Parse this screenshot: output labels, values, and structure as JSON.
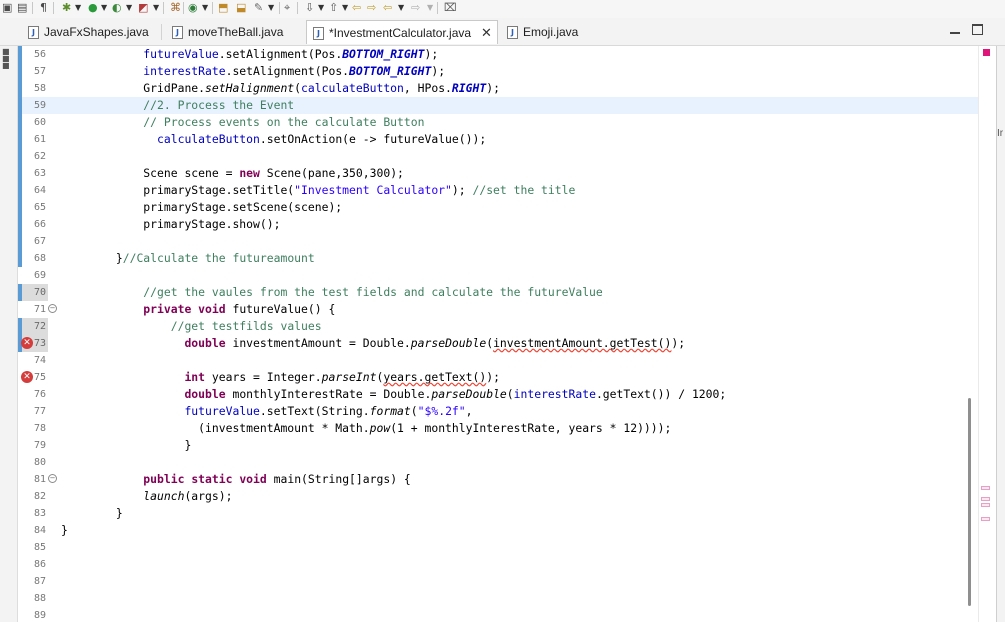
{
  "toolbar": {
    "icons": [
      "run-icon",
      "debug-icon",
      "coverage-icon",
      "external-tools-icon",
      "new-java-package-icon",
      "new-java-class-icon",
      "open-type-icon",
      "search-icon",
      "next-annotation-icon",
      "previous-annotation-icon",
      "back-icon",
      "forward-icon",
      "pin-editor-icon"
    ]
  },
  "tabs": [
    {
      "label": "JavaFxShapes.java",
      "active": false
    },
    {
      "label": "moveTheBall.java",
      "active": false
    },
    {
      "label": "*InvestmentCalculator.java",
      "active": true,
      "close": "✕"
    },
    {
      "label": "Emoji.java",
      "active": false
    }
  ],
  "right_edge": {
    "glyph_top": "",
    "glyph_bottom": "Ir"
  },
  "editor": {
    "lines": [
      {
        "num": "56",
        "segments": [
          [
            "t",
            "            "
          ],
          [
            "f",
            "futureValue"
          ],
          [
            "t",
            ".setAlignment(Pos."
          ],
          [
            "sf",
            "BOTTOM_RIGHT"
          ],
          [
            "t",
            ");"
          ]
        ]
      },
      {
        "num": "57",
        "segments": [
          [
            "t",
            "            "
          ],
          [
            "f",
            "interestRate"
          ],
          [
            "t",
            ".setAlignment(Pos."
          ],
          [
            "sf",
            "BOTTOM_RIGHT"
          ],
          [
            "t",
            ");"
          ]
        ]
      },
      {
        "num": "58",
        "segments": [
          [
            "t",
            "            GridPane."
          ],
          [
            "sm",
            "setHalignment"
          ],
          [
            "t",
            "("
          ],
          [
            "f",
            "calculateButton"
          ],
          [
            "t",
            ", HPos."
          ],
          [
            "sf",
            "RIGHT"
          ],
          [
            "t",
            ");"
          ]
        ]
      },
      {
        "num": "59",
        "segments": [
          [
            "t",
            "            "
          ],
          [
            "c",
            "//2. Process the Event"
          ]
        ]
      },
      {
        "num": "60",
        "segments": [
          [
            "t",
            "            "
          ],
          [
            "c",
            "// Process events on the calculate Button"
          ]
        ]
      },
      {
        "num": "61",
        "segments": [
          [
            "t",
            "              "
          ],
          [
            "f",
            "calculateButton"
          ],
          [
            "t",
            ".setOnAction(e -> futureValue());"
          ]
        ]
      },
      {
        "num": "62",
        "segments": []
      },
      {
        "num": "63",
        "segments": [
          [
            "t",
            "            Scene scene = "
          ],
          [
            "k",
            "new"
          ],
          [
            "t",
            " Scene(pane,350,300);"
          ]
        ]
      },
      {
        "num": "64",
        "segments": [
          [
            "t",
            "            primaryStage.setTitle("
          ],
          [
            "s",
            "\"Investment Calculator\""
          ],
          [
            "t",
            "); "
          ],
          [
            "c",
            "//set the title"
          ]
        ]
      },
      {
        "num": "65",
        "segments": [
          [
            "t",
            "            primaryStage.setScene(scene);"
          ]
        ]
      },
      {
        "num": "66",
        "segments": [
          [
            "t",
            "            primaryStage.show();"
          ]
        ]
      },
      {
        "num": "67",
        "segments": []
      },
      {
        "num": "68",
        "segments": [
          [
            "t",
            "        }"
          ],
          [
            "c",
            "//Calculate the futureamount"
          ]
        ]
      },
      {
        "num": "69",
        "segments": []
      },
      {
        "num": "70",
        "segments": [
          [
            "t",
            "            "
          ],
          [
            "c",
            "//get the vaules from the test fields and calculate the futureValue"
          ]
        ]
      },
      {
        "num": "71",
        "segments": [
          [
            "t",
            "            "
          ],
          [
            "k",
            "private"
          ],
          [
            "t",
            " "
          ],
          [
            "k",
            "void"
          ],
          [
            "t",
            " futureValue() {"
          ]
        ]
      },
      {
        "num": "72",
        "segments": [
          [
            "t",
            "                "
          ],
          [
            "c",
            "//get testfilds values"
          ]
        ]
      },
      {
        "num": "73",
        "segments": [
          [
            "t",
            "                  "
          ],
          [
            "k",
            "double"
          ],
          [
            "t",
            " investmentAmount = Double."
          ],
          [
            "sm",
            "parseDouble"
          ],
          [
            "t",
            "("
          ],
          [
            "e",
            "investmentAmount.getTest()"
          ],
          [
            "t",
            ");"
          ]
        ]
      },
      {
        "num": "74",
        "segments": []
      },
      {
        "num": "75",
        "segments": [
          [
            "t",
            "                  "
          ],
          [
            "k",
            "int"
          ],
          [
            "t",
            " years = Integer."
          ],
          [
            "sm",
            "parseInt"
          ],
          [
            "t",
            "("
          ],
          [
            "e",
            "years.getText()"
          ],
          [
            "t",
            ");"
          ]
        ]
      },
      {
        "num": "76",
        "segments": [
          [
            "t",
            "                  "
          ],
          [
            "k",
            "double"
          ],
          [
            "t",
            " monthlyInterestRate = Double."
          ],
          [
            "sm",
            "parseDouble"
          ],
          [
            "t",
            "("
          ],
          [
            "f",
            "interestRate"
          ],
          [
            "t",
            ".getText()) / 1200;"
          ]
        ]
      },
      {
        "num": "77",
        "segments": [
          [
            "t",
            "                  "
          ],
          [
            "f",
            "futureValue"
          ],
          [
            "t",
            ".setText(String."
          ],
          [
            "sm",
            "format"
          ],
          [
            "t",
            "("
          ],
          [
            "s",
            "\"$%.2f\""
          ],
          [
            "t",
            ","
          ]
        ]
      },
      {
        "num": "78",
        "segments": [
          [
            "t",
            "                    (investmentAmount * Math."
          ],
          [
            "sm",
            "pow"
          ],
          [
            "t",
            "(1 + monthlyInterestRate, years * 12))));"
          ]
        ]
      },
      {
        "num": "79",
        "segments": [
          [
            "t",
            "                  }"
          ]
        ]
      },
      {
        "num": "80",
        "segments": []
      },
      {
        "num": "81",
        "segments": [
          [
            "t",
            "            "
          ],
          [
            "k",
            "public"
          ],
          [
            "t",
            " "
          ],
          [
            "k",
            "static"
          ],
          [
            "t",
            " "
          ],
          [
            "k",
            "void"
          ],
          [
            "t",
            " main(String[]args) {"
          ]
        ]
      },
      {
        "num": "82",
        "segments": [
          [
            "t",
            "            "
          ],
          [
            "sm",
            "launch"
          ],
          [
            "t",
            "(args);"
          ]
        ]
      },
      {
        "num": "83",
        "segments": [
          [
            "t",
            "        }"
          ]
        ]
      },
      {
        "num": "84",
        "segments": [
          [
            "t",
            "}"
          ]
        ]
      },
      {
        "num": "85",
        "segments": []
      },
      {
        "num": "86",
        "segments": []
      },
      {
        "num": "87",
        "segments": []
      },
      {
        "num": "88",
        "segments": []
      },
      {
        "num": "89",
        "segments": []
      }
    ]
  },
  "colors": {
    "keyword": "#7f0055",
    "field": "#0000c0",
    "comment": "#3f7f5f",
    "string": "#2a00ff",
    "current_line": "#e8f2fe",
    "error_marker": "#d53c3c"
  }
}
